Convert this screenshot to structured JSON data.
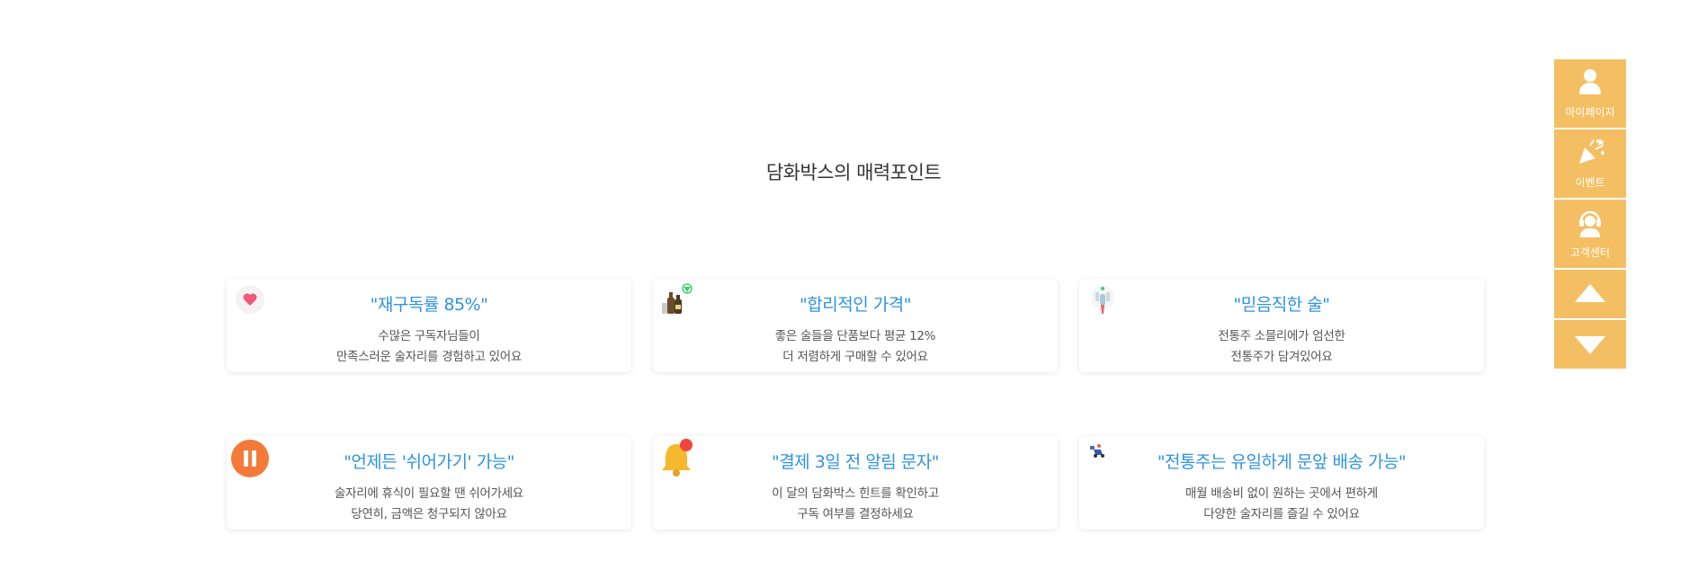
{
  "section": {
    "title": "담화박스의 매력포인트"
  },
  "cards": [
    {
      "title": "\"재구독률 85%\"",
      "line1": "수많은 구독자님들이",
      "line2": "만족스러운 술자리를 경험하고 있어요",
      "icon": "heart-bubble-icon"
    },
    {
      "title": "\"합리적인 가격\"",
      "line1": "좋은 술들을 단품보다 평균 12%",
      "line2": "더 저렴하게 구매할 수 있어요",
      "icon": "bottles-discount-icon"
    },
    {
      "title": "\"믿음직한 술\"",
      "line1": "전통주 소믈리에가 엄선한",
      "line2": "전통주가 담겨있어요",
      "icon": "sommelier-pick-icon"
    },
    {
      "title": "\"언제든 '쉬어가기' 가능\"",
      "line1": "술자리에 휴식이 필요할 땐 쉬어가세요",
      "line2": "당연히, 금액은 청구되지 않아요",
      "icon": "pause-icon"
    },
    {
      "title": "\"결제 3일 전 알림 문자\"",
      "line1": "이 달의 담화박스 힌트를 확인하고",
      "line2": "구독 여부를 결정하세요",
      "icon": "bell-notification-icon"
    },
    {
      "title": "\"전통주는 유일하게 문앞 배송 가능\"",
      "line1": "매월 배송비 없이 원하는 곳에서 편하게",
      "line2": "다양한 술자리를 즐길 수 있어요",
      "icon": "delivery-scooter-icon"
    }
  ],
  "quick_menu": {
    "mypage": "마이페이지",
    "event": "이벤트",
    "support": "고객센터",
    "up": "scroll-up-icon",
    "down": "scroll-down-icon"
  },
  "colors": {
    "accent_blue": "#2f93e0",
    "quick_menu_bg": "#f4bf63",
    "pause_orange": "#f47a3a",
    "bell_yellow": "#f5b82e",
    "heart_pink": "#f05a7a"
  }
}
